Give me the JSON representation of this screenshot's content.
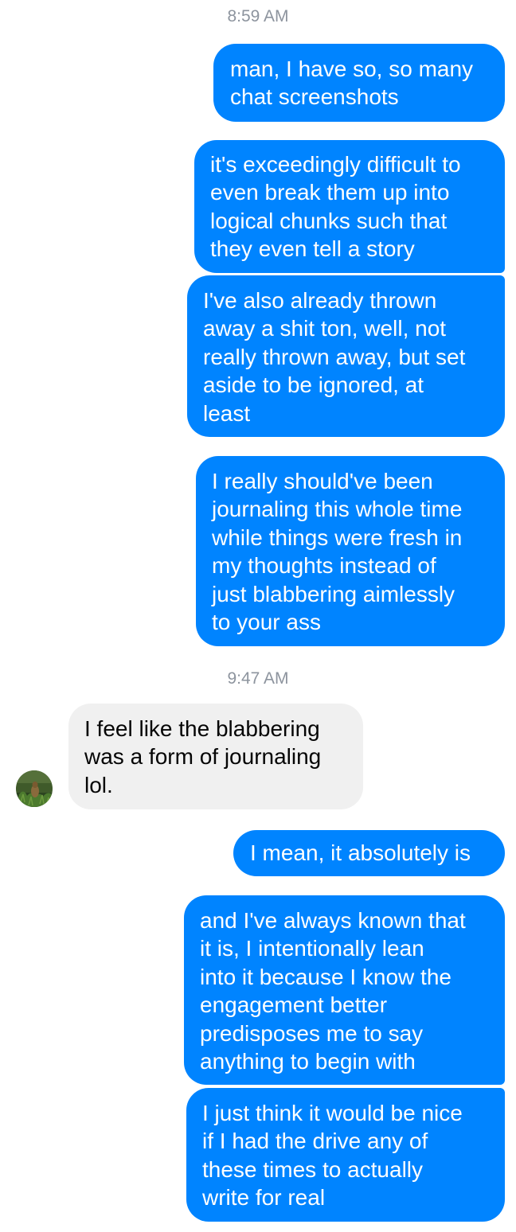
{
  "timestamps": [
    "8:59 AM",
    "9:47 AM"
  ],
  "colors": {
    "sent_bubble": "#0084ff",
    "received_bubble": "#f0f0f0",
    "timestamp": "#8d949e"
  },
  "messages": [
    {
      "direction": "sent",
      "lines": [
        "man, I have so, so many",
        "chat screenshots"
      ]
    },
    {
      "direction": "sent",
      "lines": [
        "it's exceedingly difficult to",
        "even break them up into",
        "logical chunks such that",
        "they even tell a story"
      ]
    },
    {
      "direction": "sent",
      "lines": [
        "I've also already thrown",
        "away a shit ton, well, not",
        "really thrown away, but set",
        "aside to be ignored, at",
        "least"
      ]
    },
    {
      "direction": "sent",
      "lines": [
        "I really should've been",
        "journaling this whole time",
        "while things were fresh in",
        "my thoughts instead of",
        "just blabbering aimlessly",
        "to your ass"
      ]
    },
    {
      "direction": "received",
      "lines": [
        "I feel like the blabbering",
        "was a form of journaling",
        "lol."
      ]
    },
    {
      "direction": "sent",
      "lines": [
        "I mean, it absolutely is"
      ]
    },
    {
      "direction": "sent",
      "lines": [
        "and I've always known that",
        "it is, I intentionally lean",
        "into it because I know the",
        "engagement better",
        "predisposes me to say",
        "anything to begin with"
      ]
    },
    {
      "direction": "sent",
      "lines": [
        "I just think it would be nice",
        "if I had the drive any of",
        "these times to actually",
        "write for real"
      ]
    }
  ],
  "contact_avatar": {
    "icon": "contact-avatar-photo"
  }
}
